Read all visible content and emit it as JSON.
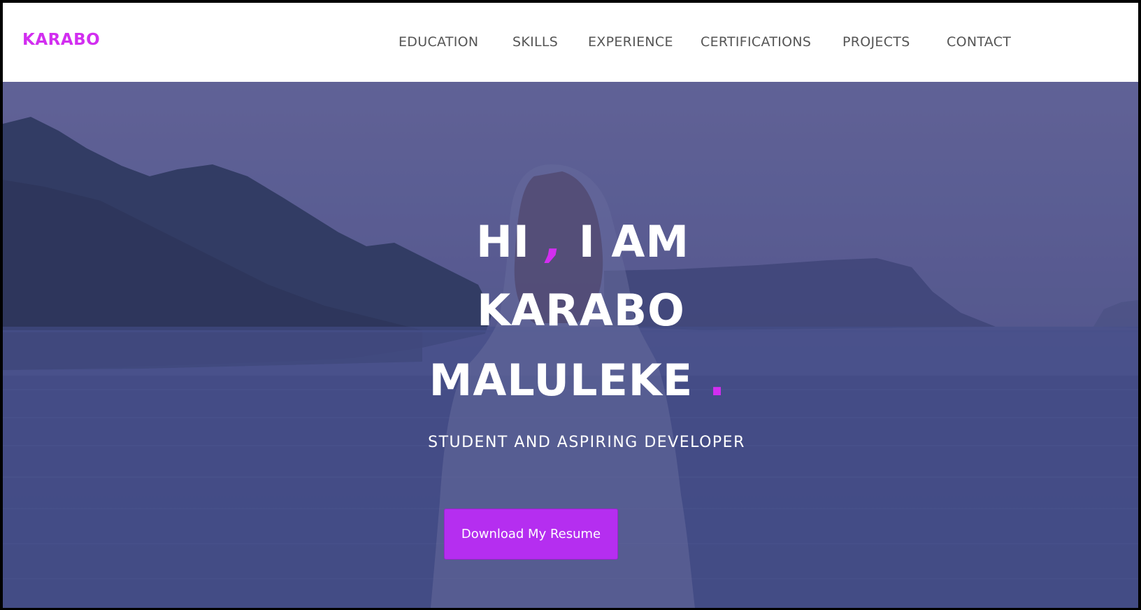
{
  "header": {
    "brand": "KARABO",
    "nav": [
      "EDUCATION",
      "SKILLS",
      "EXPERIENCE",
      "CERTIFICATIONS",
      "PROJECTS",
      "CONTACT"
    ]
  },
  "hero": {
    "line1_a": "HI",
    "line1_comma": ",",
    "line1_b": "I AM",
    "line2": "KARABO",
    "line3": "MALULEKE",
    "line3_dot": ".",
    "subtitle": "STUDENT AND ASPIRING DEVELOPER",
    "cta_label": "Download My Resume"
  },
  "colors": {
    "accent": "#d22ef0",
    "button": "#b52ef0",
    "overlay": "#5b5f92",
    "nav_text": "#555555"
  }
}
